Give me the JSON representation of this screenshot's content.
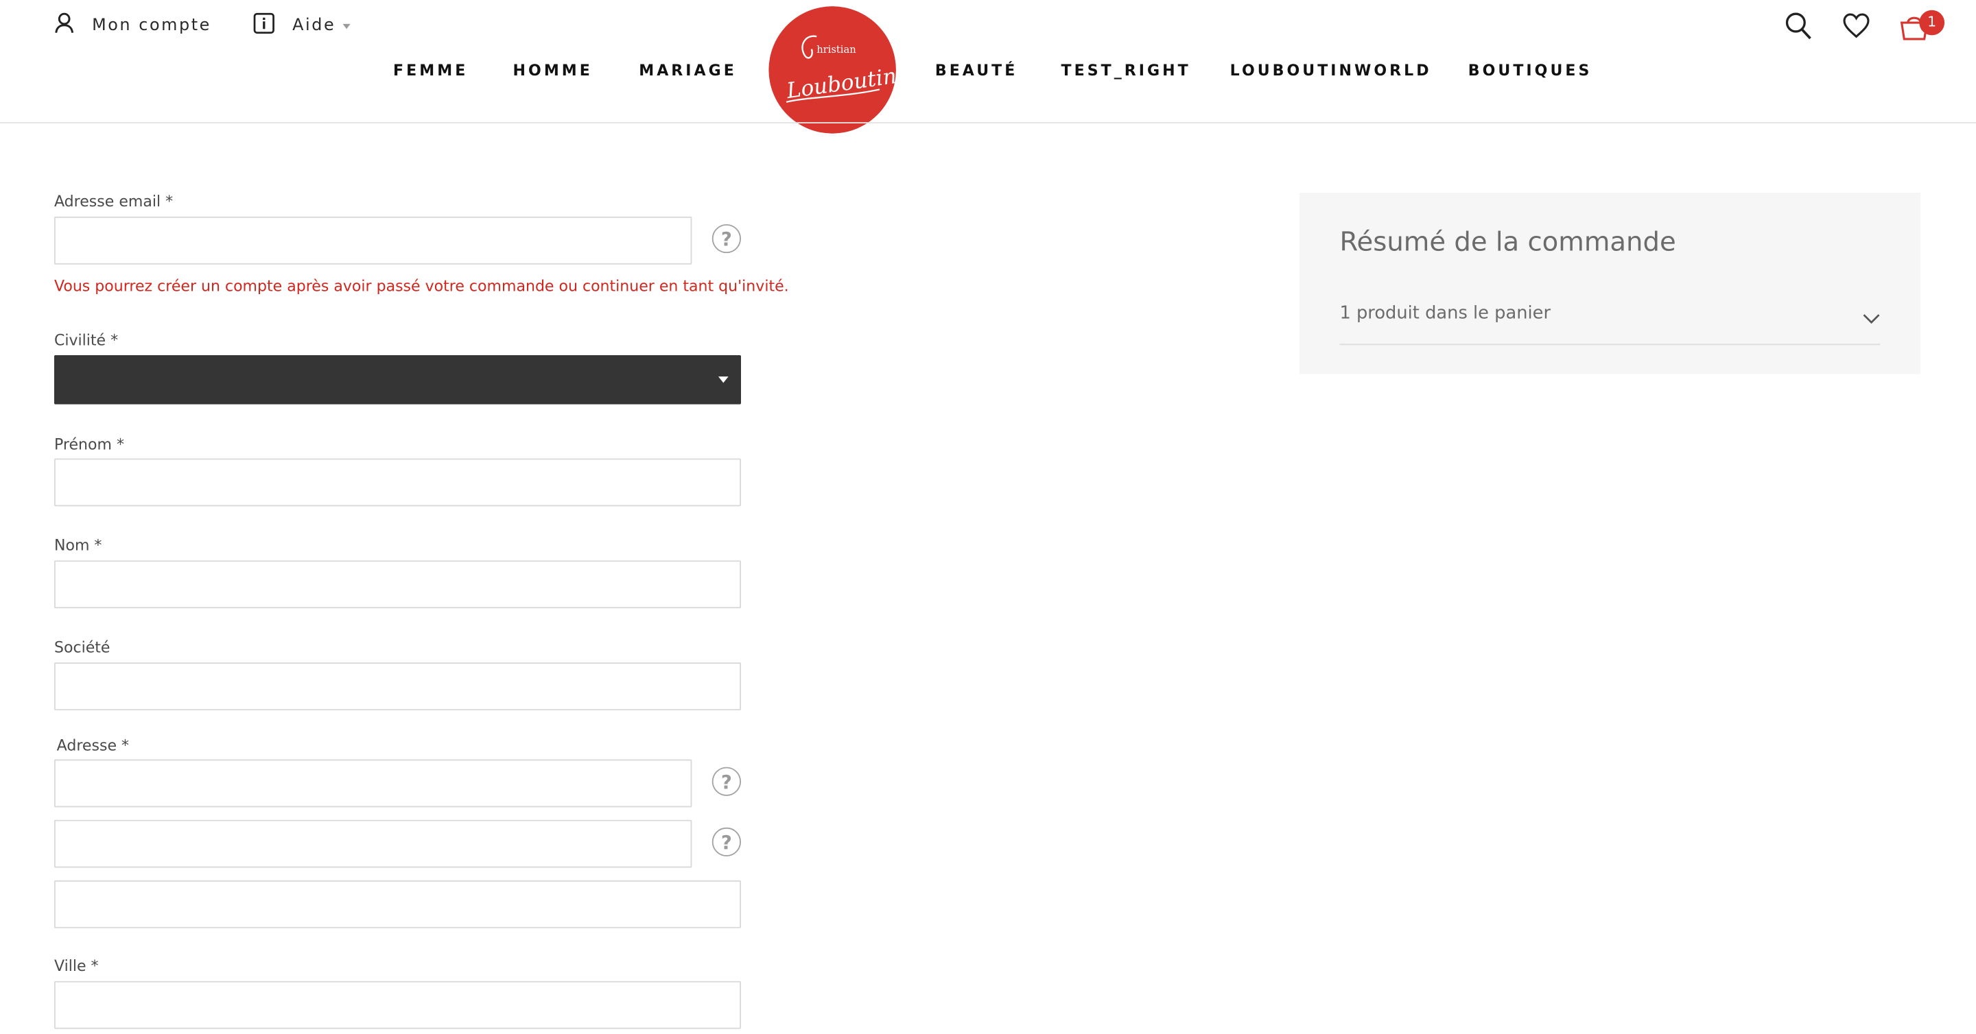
{
  "header": {
    "account_label": "Mon compte",
    "help_label": "Aide",
    "nav_left": [
      "FEMME",
      "HOMME",
      "MARIAGE"
    ],
    "nav_right": [
      "BEAUTÉ",
      "TEST_RIGHT",
      "LOUBOUTINWORLD",
      "BOUTIQUES"
    ],
    "logo": {
      "line1": "hristian",
      "line2": "Louboutin",
      "bg_color": "#d7352e"
    },
    "cart_count": "1",
    "accent_color": "#d7352e"
  },
  "form": {
    "email": {
      "label": "Adresse email *",
      "value": "",
      "placeholder": ""
    },
    "email_message": "Vous pourrez créer un compte après avoir passé votre commande ou continuer en tant qu'invité.",
    "civilite": {
      "label": "Civilité *",
      "selected": ""
    },
    "prenom": {
      "label": "Prénom *",
      "value": ""
    },
    "nom": {
      "label": "Nom *",
      "value": ""
    },
    "societe": {
      "label": "Société",
      "value": ""
    },
    "adresse": {
      "label": "Adresse *",
      "line1": "",
      "line2": "",
      "line3": ""
    },
    "ville": {
      "label": "Ville *",
      "value": ""
    },
    "help_glyph": "?"
  },
  "summary": {
    "title": "Résumé de la commande",
    "products_label": "1 produit dans le panier"
  }
}
